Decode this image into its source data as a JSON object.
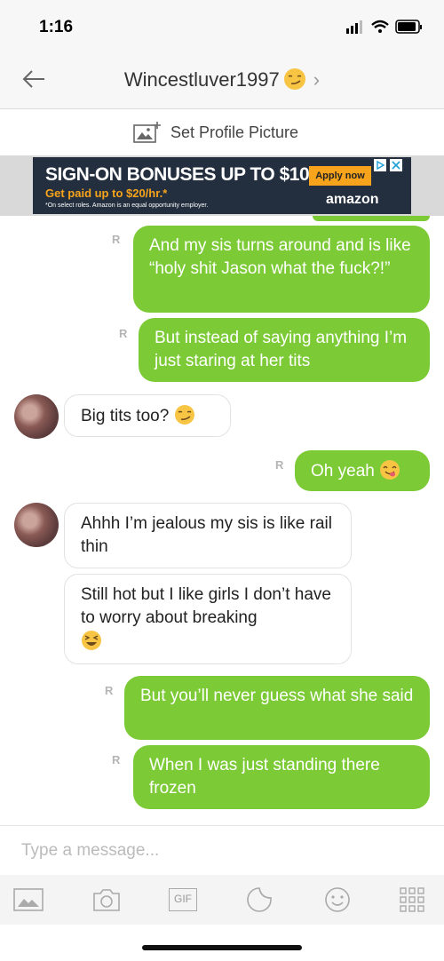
{
  "status_bar": {
    "time": "1:16"
  },
  "header": {
    "title": "Wincestluver1997"
  },
  "set_profile": {
    "label": "Set Profile Picture"
  },
  "ad": {
    "headline": "SIGN-ON BONUSES UP TO $1000",
    "subline": "Get paid up to $20/hr.*",
    "fine_print": "*On select roles. Amazon is an equal opportunity employer.",
    "button_label": "Apply now",
    "brand": "amazon"
  },
  "messages": [
    {
      "sender": "me",
      "text": "And my sis turns around and is like “holy shit Jason what the fuck?!”",
      "receipt": "R"
    },
    {
      "sender": "me",
      "text": "But instead of saying anything I’m just staring at her tits",
      "receipt": "R"
    },
    {
      "sender": "them",
      "text": "Big tits too?",
      "emoji": "smirk"
    },
    {
      "sender": "me",
      "text": "Oh yeah",
      "emoji": "yum",
      "receipt": "R"
    },
    {
      "sender": "them",
      "text": "Ahhh I’m jealous my sis is like rail thin"
    },
    {
      "sender": "them",
      "text": "Still hot but I like girls I don’t have to worry about breaking",
      "emoji": "laughing"
    },
    {
      "sender": "me",
      "text": "But you’ll never guess what she said",
      "receipt": "R"
    },
    {
      "sender": "me",
      "text": "When I was just standing there frozen",
      "receipt": "R"
    }
  ],
  "composer": {
    "placeholder": "Type a message..."
  },
  "toolbar": {
    "gif_label": "GIF"
  },
  "colors": {
    "outgoing_bubble": "#7ccb36",
    "accent": "#7ccb36"
  }
}
